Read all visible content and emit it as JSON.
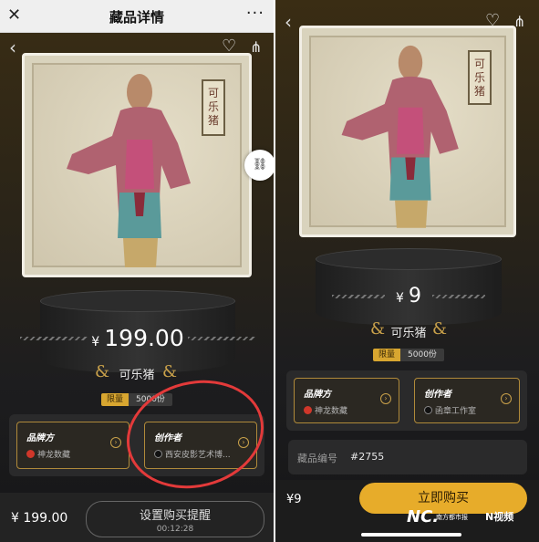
{
  "left": {
    "titlebar": {
      "close": "✕",
      "title": "藏品详情",
      "more": "···"
    },
    "nav": {
      "back": "‹",
      "heart": "♡",
      "share": "⋔"
    },
    "art_stamp": "可乐猪",
    "price": {
      "currency": "¥",
      "value": "199.00"
    },
    "item_name": "可乐猪",
    "limit": {
      "label": "限量",
      "count": "5000份"
    },
    "brand_card": {
      "title": "品牌方",
      "value": "神龙数藏"
    },
    "creator_card": {
      "title": "创作者",
      "value": "西安皮影艺术博..."
    },
    "bottom": {
      "price": "¥ 199.00",
      "button": "设置购买提醒",
      "countdown": "00:12:28"
    }
  },
  "right": {
    "nav": {
      "back": "‹",
      "heart": "♡",
      "share": "⋔"
    },
    "art_stamp": "可乐猪",
    "price": {
      "currency": "¥",
      "value": "9"
    },
    "item_name": "可乐猪",
    "limit": {
      "label": "限量",
      "count": "5000份"
    },
    "brand_card": {
      "title": "品牌方",
      "value": "神龙数藏"
    },
    "creator_card": {
      "title": "创作者",
      "value": "函章工作室"
    },
    "serial": {
      "key": "藏品编号",
      "value": "#2755"
    },
    "bottom": {
      "price": "¥9",
      "button": "立即购买"
    },
    "watermark": {
      "left": "NC.",
      "left_small": "南方都市报",
      "right": "N视频"
    }
  },
  "colors": {
    "gold": "#e7ac2a",
    "annotation": "#e33a3a"
  }
}
